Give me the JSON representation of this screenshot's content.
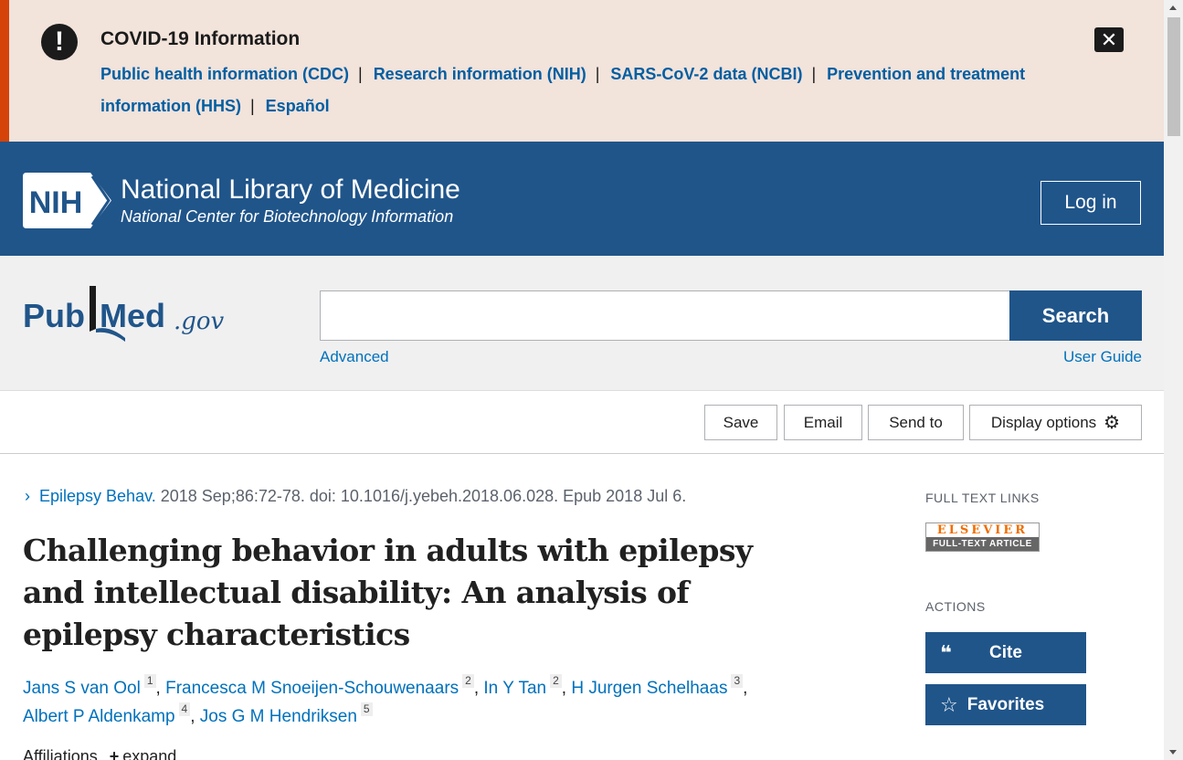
{
  "covid_banner": {
    "title": "COVID-19 Information",
    "links": [
      "Public health information (CDC)",
      "Research information (NIH)",
      "SARS-CoV-2 data (NCBI)",
      "Prevention and treatment information (HHS)",
      "Español"
    ],
    "separator": "|"
  },
  "nih_header": {
    "logo_text": "NIH",
    "org_name": "National Library of Medicine",
    "org_sub": "National Center for Biotechnology Information",
    "login_label": "Log in"
  },
  "search": {
    "logo_pub": "Pub",
    "logo_med": "Med",
    "logo_gov": ".gov",
    "value": "",
    "button_label": "Search",
    "advanced_label": "Advanced",
    "user_guide_label": "User Guide"
  },
  "toolbar": {
    "save": "Save",
    "email": "Email",
    "send_to": "Send to",
    "display_options": "Display options"
  },
  "article": {
    "journal": "Epilepsy Behav.",
    "citation": " 2018 Sep;86:72-78. doi: 10.1016/j.yebeh.2018.06.028. Epub 2018 Jul 6.",
    "title": "Challenging behavior in adults with epilepsy and intellectual disability: An analysis of epilepsy characteristics",
    "authors": [
      {
        "name": "Jans S van Ool",
        "aff": "1"
      },
      {
        "name": "Francesca M Snoeijen-Schouwenaars",
        "aff": "2"
      },
      {
        "name": "In Y Tan",
        "aff": "2"
      },
      {
        "name": "H Jurgen Schelhaas",
        "aff": "3"
      },
      {
        "name": "Albert P Aldenkamp",
        "aff": "4"
      },
      {
        "name": "Jos G M Hendriksen",
        "aff": "5"
      }
    ],
    "affiliations_label": "Affiliations",
    "expand_label": "expand"
  },
  "sidebar": {
    "full_text_heading": "FULL TEXT LINKS",
    "elsevier_top": "ELSEVIER",
    "elsevier_bottom": "FULL-TEXT ARTICLE",
    "actions_heading": "ACTIONS",
    "cite_label": "Cite",
    "favorites_label": "Favorites"
  },
  "colors": {
    "banner_bg": "#f2e3db",
    "banner_accent": "#d54309",
    "nih_blue": "#20558a",
    "link_blue": "#0071bc"
  }
}
